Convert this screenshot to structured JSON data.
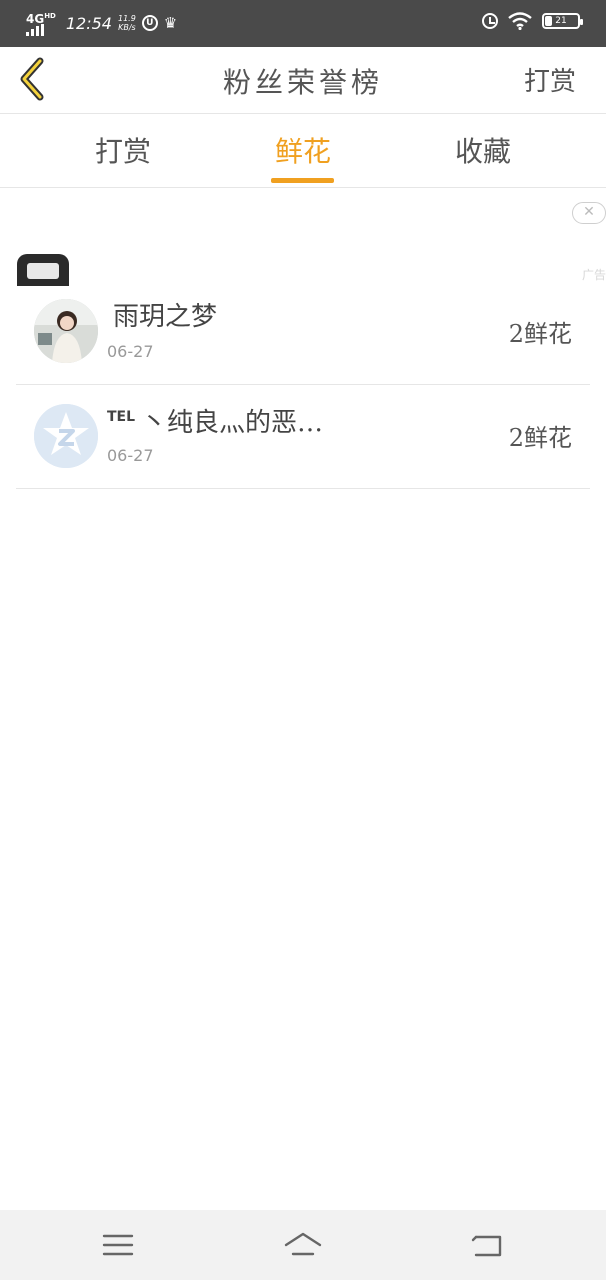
{
  "status_bar": {
    "network": "4G",
    "network_sup": "HD",
    "time": "12:54",
    "speed_value": "11.9",
    "speed_unit": "KB/s",
    "battery": "21"
  },
  "header": {
    "title": "粉丝荣誉榜",
    "action_label": "打赏"
  },
  "tabs": [
    {
      "label": "打赏",
      "active": false
    },
    {
      "label": "鲜花",
      "active": true
    },
    {
      "label": "收藏",
      "active": false
    }
  ],
  "ad": {
    "close_glyph": "✕",
    "label": "广告"
  },
  "fans": [
    {
      "prefix": "",
      "name": "雨玥之梦",
      "date": "06-27",
      "count": "2鲜花"
    },
    {
      "prefix": "TEL",
      "name": "丶纯良灬的恶…",
      "date": "06-27",
      "count": "2鲜花"
    }
  ],
  "colors": {
    "accent": "#f0a020",
    "status_bar": "#4a4a4a",
    "divider": "#e6e6e6"
  },
  "icons": [
    "back-chevron-icon",
    "menu-icon",
    "home-icon",
    "return-icon",
    "alarm-icon",
    "wifi-icon",
    "battery-icon",
    "crown-icon"
  ]
}
